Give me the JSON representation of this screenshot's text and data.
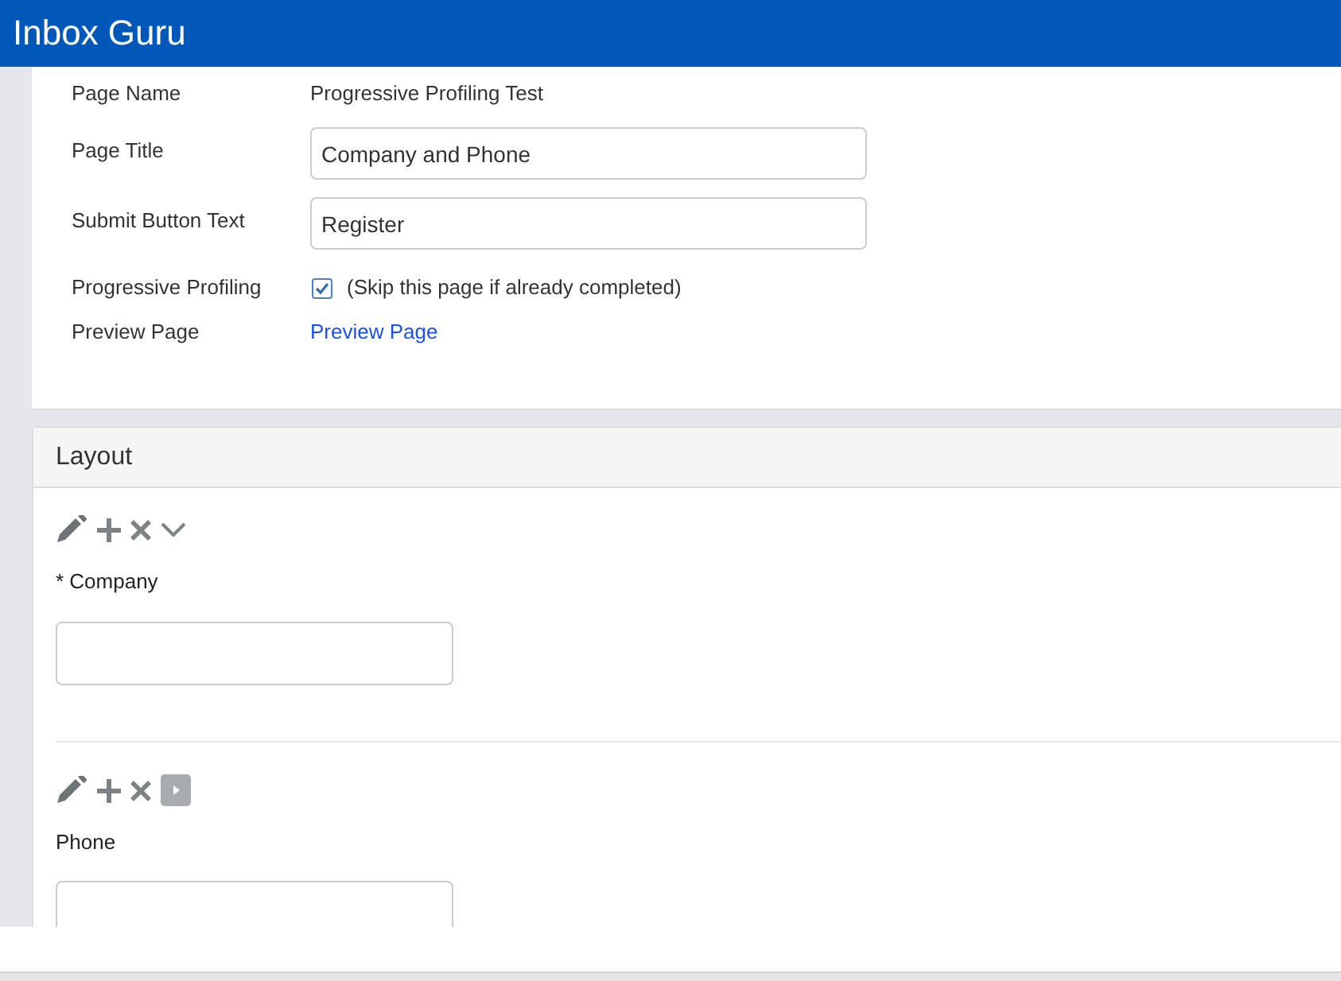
{
  "header": {
    "title": "Inbox Guru"
  },
  "settings": {
    "rows": [
      {
        "kind": "text",
        "label": "Page Name",
        "value": "Progressive Profiling Test"
      },
      {
        "kind": "input",
        "label": "Page Title",
        "value": "Company and Phone"
      },
      {
        "kind": "input",
        "label": "Submit Button Text",
        "value": "Register"
      },
      {
        "kind": "checkbox",
        "label": "Progressive Profiling",
        "checked": true,
        "text": "(Skip this page if already completed)"
      },
      {
        "kind": "link",
        "label": "Preview Page",
        "text": "Preview Page"
      }
    ]
  },
  "layout": {
    "title": "Layout",
    "fields": [
      {
        "tools": [
          {
            "kind": "pencil"
          },
          {
            "kind": "plus"
          },
          {
            "kind": "cross"
          },
          {
            "kind": "chevron"
          }
        ],
        "label": "* Company"
      },
      {
        "tools": [
          {
            "kind": "pencil"
          },
          {
            "kind": "plus"
          },
          {
            "kind": "cross"
          },
          {
            "kind": "tile"
          }
        ],
        "label": "Phone"
      }
    ]
  }
}
